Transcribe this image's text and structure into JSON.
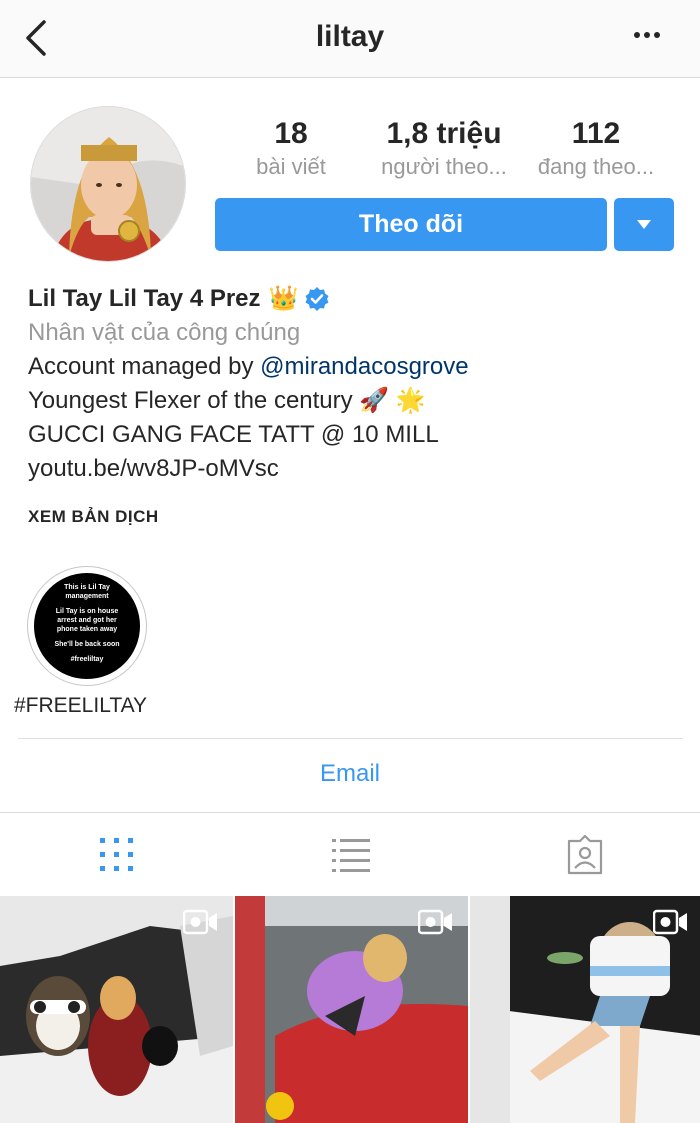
{
  "header": {
    "username": "liltay"
  },
  "stats": [
    {
      "value": "18",
      "label": "bài viết"
    },
    {
      "value": "1,8 triệu",
      "label": "người theo..."
    },
    {
      "value": "112",
      "label": "đang theo..."
    }
  ],
  "follow": {
    "label": "Theo dõi"
  },
  "bio": {
    "name": "Lil Tay Lil Tay 4 Prez",
    "name_emoji": "👑",
    "category": "Nhân vật của công chúng",
    "managed_prefix": "Account managed by ",
    "managed_handle": "@mirandacosgrove",
    "line2": "Youngest Flexer of the century",
    "line2_emoji": "🚀 🌟",
    "line3": "GUCCI GANG FACE TATT @ 10 MILL",
    "link": "youtu.be/wv8JP-oMVsc",
    "translate": "XEM BẢN DỊCH"
  },
  "highlight": {
    "label": "#FREELILTAY",
    "cover_lines": [
      "This is Lil Tay management",
      "Lil Tay is on house arrest and got her phone taken away",
      "She'll be back soon",
      "#freeliltay"
    ]
  },
  "contact": {
    "email_label": "Email"
  },
  "colors": {
    "accent": "#3897f0",
    "link": "#003569",
    "muted": "#999999",
    "verified": "#3897f0"
  },
  "icons": {
    "back": "chevron-left-icon",
    "more": "more-horizontal-icon",
    "grid": "grid-icon",
    "list": "list-icon",
    "tagged": "tagged-icon",
    "video": "video-camera-icon"
  }
}
